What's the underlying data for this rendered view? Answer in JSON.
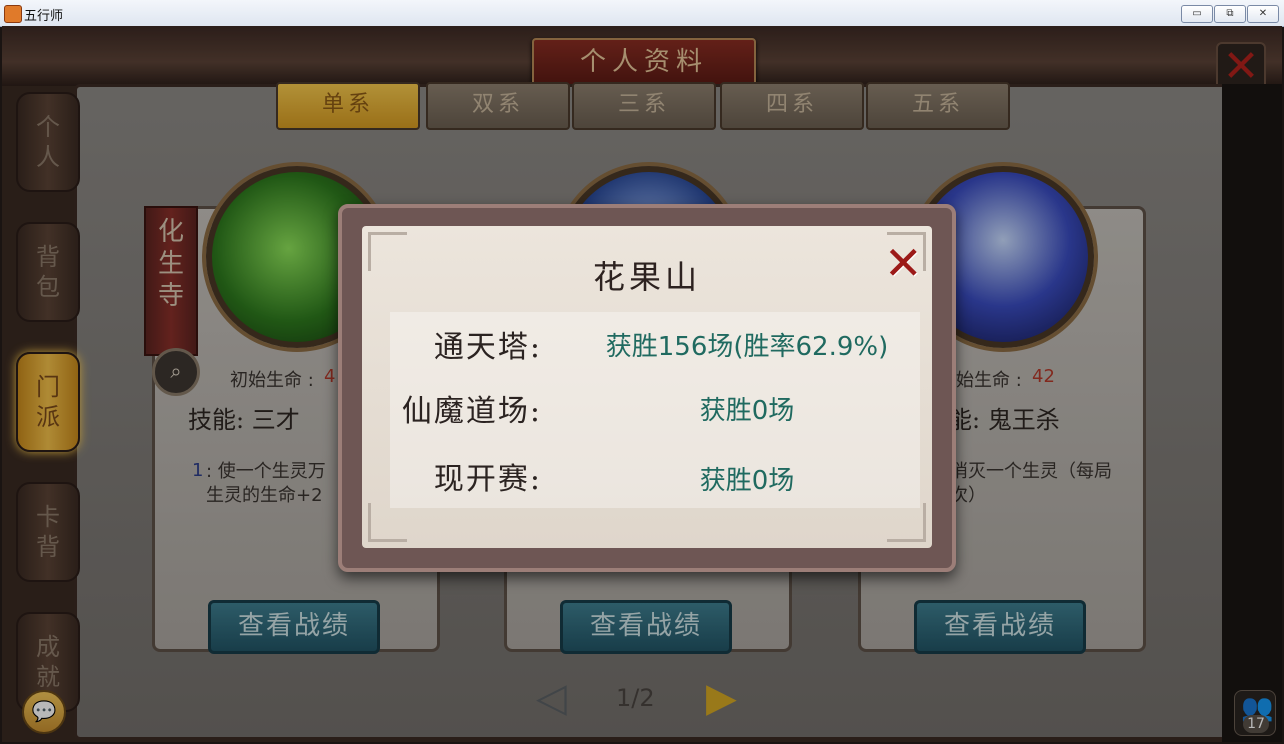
{
  "window": {
    "title": "五行师",
    "minimize": "▭",
    "restore": "⧉",
    "close": "✕"
  },
  "header": {
    "title": "个人资料",
    "close_icon": "✕"
  },
  "side_tabs": [
    {
      "label": "个\n人",
      "active": false
    },
    {
      "label": "背\n包",
      "active": false
    },
    {
      "label": "门\n派",
      "active": true
    },
    {
      "label": "卡\n背",
      "active": false
    },
    {
      "label": "成\n就",
      "active": false
    }
  ],
  "top_tabs": [
    "单系",
    "双系",
    "三系",
    "四系",
    "五系"
  ],
  "sect_tag": "化\n生\n寺",
  "cards": [
    {
      "hp_label": "初始生命 :",
      "hp_value": "4",
      "skill": "技能: 三才",
      "desc_num": "1",
      "desc": ": 使一个生灵万\n生灵的生命+2",
      "button": "查看战绩"
    },
    {
      "button": "查看战绩"
    },
    {
      "hp_label": "初始生命 :",
      "hp_value": "42",
      "skill": "能: 鬼王杀",
      "desc": "消灭一个生灵（每局\n次）",
      "button": "查看战绩"
    }
  ],
  "pager": {
    "text": "1/2",
    "prev": "◁",
    "next": "▶"
  },
  "modal": {
    "title": "花果山",
    "close_icon": "✕",
    "rows": [
      {
        "label": "通天塔:",
        "value": "获胜156场(胜率62.9%)"
      },
      {
        "label": "仙魔道场:",
        "value": "获胜0场"
      },
      {
        "label": "现开赛:",
        "value": "获胜0场"
      }
    ]
  },
  "chat_icon": "💬",
  "online": {
    "icon": "👥",
    "count": "17"
  }
}
